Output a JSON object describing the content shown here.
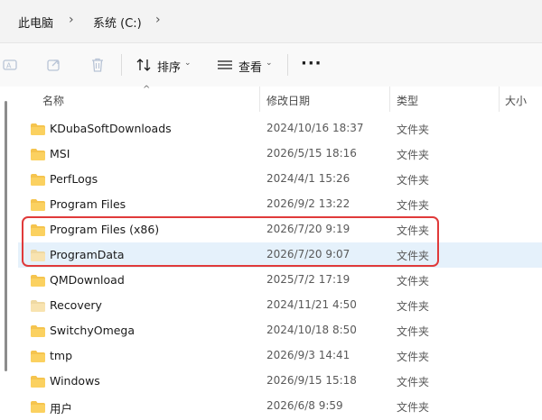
{
  "breadcrumb": {
    "items": [
      "此电脑",
      "系统 (C:)"
    ]
  },
  "toolbar": {
    "sort_label": "排序",
    "view_label": "查看",
    "more_label": "···"
  },
  "columns": {
    "name": "名称",
    "modified": "修改日期",
    "type": "类型",
    "size": "大小"
  },
  "files": [
    {
      "name": "KDubaSoftDownloads",
      "modified": "2024/10/16 18:37",
      "type": "文件夹"
    },
    {
      "name": "MSI",
      "modified": "2026/5/15 18:16",
      "type": "文件夹"
    },
    {
      "name": "PerfLogs",
      "modified": "2024/4/1 15:26",
      "type": "文件夹"
    },
    {
      "name": "Program Files",
      "modified": "2026/9/2 13:22",
      "type": "文件夹"
    },
    {
      "name": "Program Files (x86)",
      "modified": "2026/7/20 9:19",
      "type": "文件夹"
    },
    {
      "name": "ProgramData",
      "modified": "2026/7/20 9:07",
      "type": "文件夹"
    },
    {
      "name": "QMDownload",
      "modified": "2025/7/2 17:19",
      "type": "文件夹"
    },
    {
      "name": "Recovery",
      "modified": "2024/11/21 4:50",
      "type": "文件夹"
    },
    {
      "name": "SwitchyOmega",
      "modified": "2024/10/18 8:50",
      "type": "文件夹"
    },
    {
      "name": "tmp",
      "modified": "2026/9/3 14:41",
      "type": "文件夹"
    },
    {
      "name": "Windows",
      "modified": "2026/9/15 15:18",
      "type": "文件夹"
    },
    {
      "name": "用户",
      "modified": "2026/6/8 9:59",
      "type": "文件夹"
    }
  ],
  "colors": {
    "folder": "#f5c44e",
    "folder_hidden": "#f8e3b0",
    "selection": "#e5f1fb",
    "highlight_box": "#e03a3a"
  }
}
